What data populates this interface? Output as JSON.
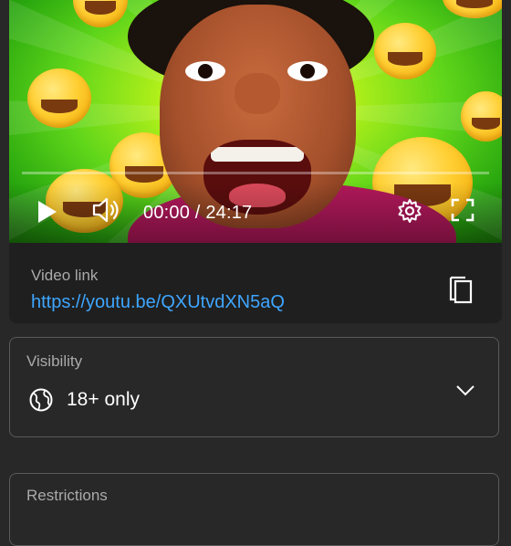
{
  "player": {
    "current_time": "00:00",
    "time_separator": "/",
    "duration": "24:17",
    "time_display": "00:00 / 24:17",
    "progress_fraction": 0,
    "icons": {
      "play": "play-icon",
      "volume": "volume-icon",
      "settings": "gear-icon",
      "fullscreen": "fullscreen-icon"
    }
  },
  "video_link": {
    "label": "Video link",
    "url": "https://youtu.be/QXUtvdXN5aQ",
    "copy_icon": "copy-icon"
  },
  "visibility": {
    "label": "Visibility",
    "value": "18+ only",
    "icon": "globe-icon",
    "dropdown_icon": "chevron-down-icon"
  },
  "restrictions": {
    "label": "Restrictions"
  },
  "colors": {
    "background": "#282828",
    "link": "#3ea6ff",
    "label": "#aaaaaa",
    "border": "#5a5a5a"
  }
}
